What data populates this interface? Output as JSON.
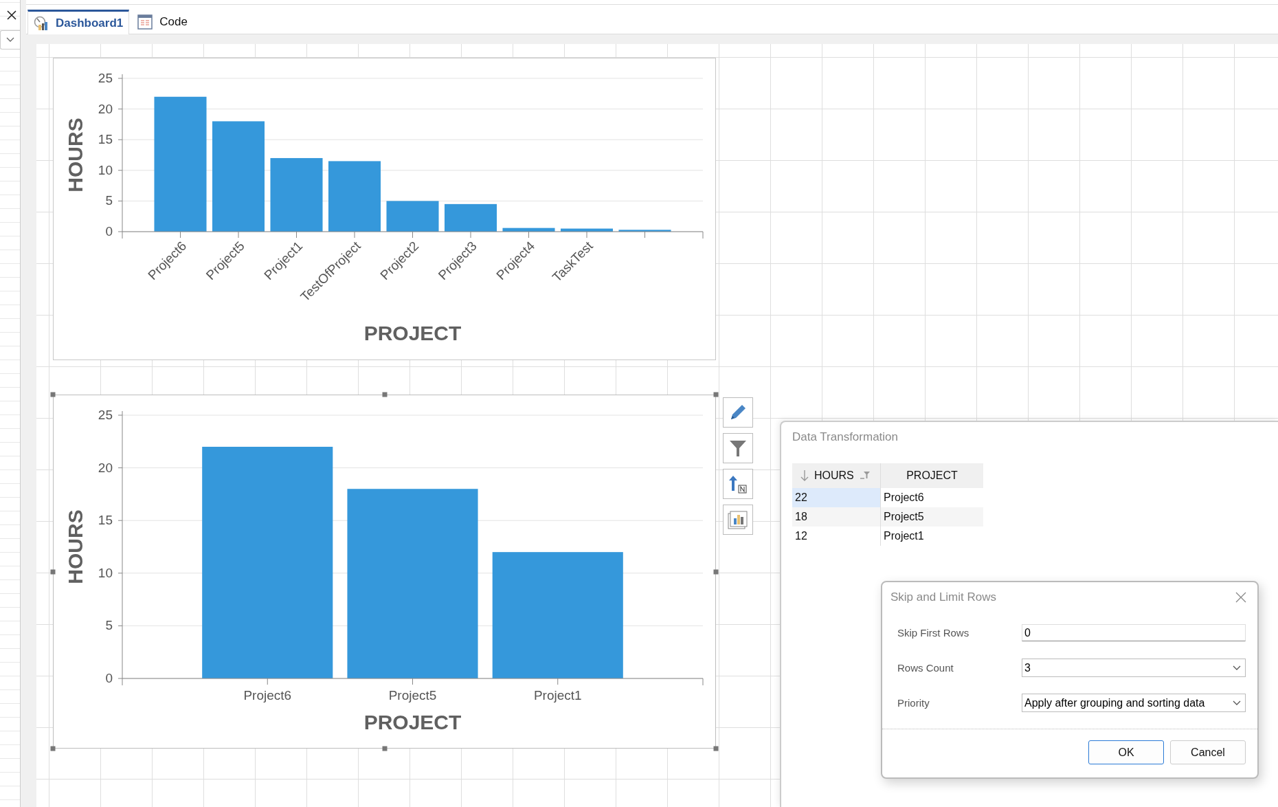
{
  "tabs": [
    {
      "label": "Dashboard1",
      "kind": "dashboard",
      "selected": true
    },
    {
      "label": "Code",
      "kind": "code",
      "selected": false
    }
  ],
  "dashboard": {
    "items": [
      {
        "selected": false,
        "chart_data": {
          "type": "bar",
          "xlabel": "PROJECT",
          "ylabel": "HOURS",
          "categories": [
            "Project6",
            "Project5",
            "Project1",
            "TestOfProject",
            "Project2",
            "Project3",
            "Project4",
            "TaskTest",
            null
          ],
          "values": [
            22,
            18,
            12,
            11.5,
            5,
            4.5,
            0.6,
            0.5,
            0.3
          ],
          "grid": true,
          "ylim": [
            0,
            25
          ],
          "yticks": [
            0,
            5,
            10,
            15,
            20,
            25
          ]
        }
      },
      {
        "selected": true,
        "chart_data": {
          "type": "bar",
          "xlabel": "PROJECT",
          "ylabel": "HOURS",
          "categories": [
            "Project6",
            "Project5",
            "Project1"
          ],
          "values": [
            22,
            18,
            12
          ],
          "grid": true,
          "ylim": [
            0,
            25
          ],
          "yticks": [
            0,
            5,
            10,
            15,
            20,
            25
          ]
        }
      }
    ]
  },
  "data_transformation": {
    "title": "Data Transformation",
    "columns": [
      {
        "label": "HOURS",
        "sorted": true,
        "filter": true
      },
      {
        "label": "PROJECT",
        "sorted": false,
        "filter": false
      }
    ],
    "rows": [
      {
        "cells": [
          "22",
          "Project6"
        ],
        "selected": true
      },
      {
        "cells": [
          "18",
          "Project5"
        ],
        "selected": false
      },
      {
        "cells": [
          "12",
          "Project1"
        ],
        "selected": false
      }
    ]
  },
  "dialog": {
    "title": "Skip and Limit Rows",
    "fields": [
      {
        "label": "Skip First Rows",
        "value": "0",
        "kind": "text"
      },
      {
        "label": "Rows Count",
        "value": "3",
        "kind": "dropdown"
      },
      {
        "label": "Priority",
        "value": "Apply after grouping and sorting data",
        "kind": "dropdown"
      }
    ],
    "buttons": [
      {
        "label": "OK",
        "default": true
      },
      {
        "label": "Cancel",
        "default": false
      }
    ]
  }
}
